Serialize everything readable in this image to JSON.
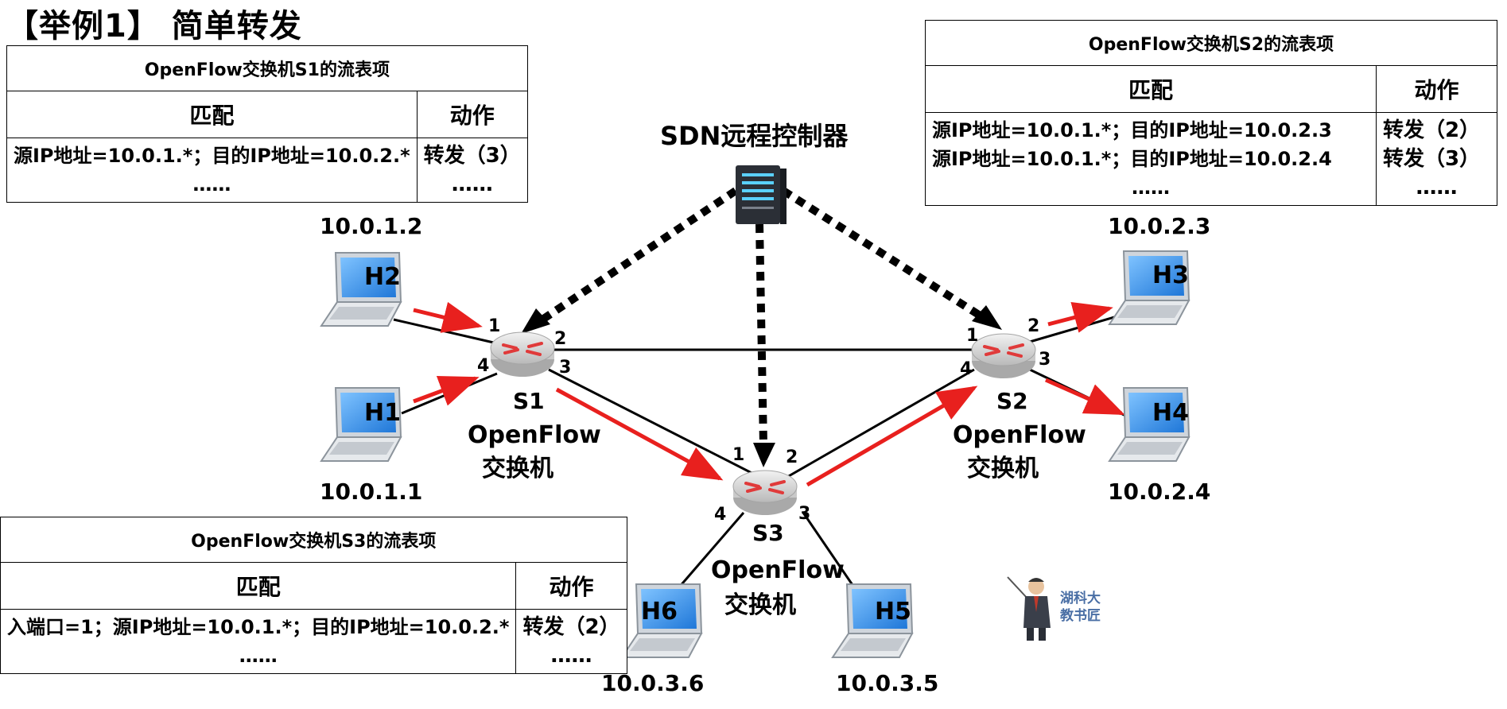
{
  "title": "【举例1】 简单转发",
  "controller": {
    "label": "SDN远程控制器"
  },
  "tables": {
    "s1": {
      "caption": "OpenFlow交换机S1的流表项",
      "match_header": "匹配",
      "action_header": "动作",
      "rows": [
        {
          "match": "源IP地址=10.0.1.*；目的IP地址=10.0.2.*",
          "action": "转发（3）"
        },
        {
          "match": "……",
          "action": "……"
        }
      ]
    },
    "s2": {
      "caption": "OpenFlow交换机S2的流表项",
      "match_header": "匹配",
      "action_header": "动作",
      "rows": [
        {
          "match": "源IP地址=10.0.1.*；目的IP地址=10.0.2.3",
          "action": "转发（2）"
        },
        {
          "match": "源IP地址=10.0.1.*；目的IP地址=10.0.2.4",
          "action": "转发（3）"
        },
        {
          "match": "……",
          "action": "……"
        }
      ]
    },
    "s3": {
      "caption": "OpenFlow交换机S3的流表项",
      "match_header": "匹配",
      "action_header": "动作",
      "rows": [
        {
          "match": "入端口=1；源IP地址=10.0.1.*；目的IP地址=10.0.2.*",
          "action": "转发（2）"
        },
        {
          "match": "……",
          "action": "……"
        }
      ]
    }
  },
  "switches": {
    "s1": {
      "name": "S1",
      "type_line1": "OpenFlow",
      "type_line2": "交换机",
      "ports": [
        "1",
        "2",
        "3",
        "4"
      ]
    },
    "s2": {
      "name": "S2",
      "type_line1": "OpenFlow",
      "type_line2": "交换机",
      "ports": [
        "1",
        "2",
        "3",
        "4"
      ]
    },
    "s3": {
      "name": "S3",
      "type_line1": "OpenFlow",
      "type_line2": "交换机",
      "ports": [
        "1",
        "2",
        "3",
        "4"
      ]
    }
  },
  "hosts": {
    "h1": {
      "name": "H1",
      "ip": "10.0.1.1"
    },
    "h2": {
      "name": "H2",
      "ip": "10.0.1.2"
    },
    "h3": {
      "name": "H3",
      "ip": "10.0.2.3"
    },
    "h4": {
      "name": "H4",
      "ip": "10.0.2.4"
    },
    "h5": {
      "name": "H5",
      "ip": "10.0.3.5"
    },
    "h6": {
      "name": "H6",
      "ip": "10.0.3.6"
    }
  },
  "watermark": {
    "line1": "湖科大",
    "line2": "教书匠"
  },
  "colors": {
    "flow_arrow": "#e8201e",
    "laptop_screen": "#2f8fe8",
    "router": "#d9d9d9",
    "router_arrow": "#e03a3a",
    "server": "#2b2f36"
  }
}
